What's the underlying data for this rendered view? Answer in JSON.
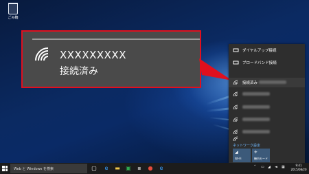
{
  "desktop": {
    "recycle_bin_label": "ごみ箱"
  },
  "callout": {
    "ssid": "XXXXXXXXX",
    "status": "接続済み"
  },
  "network_panel": {
    "items": [
      {
        "label": "ダイヤルアップ接続",
        "icon": "dialup-icon"
      },
      {
        "label": "ブロードバンド接続",
        "icon": "broadband-icon"
      },
      {
        "label": "接続済み",
        "icon": "wifi-icon",
        "selected": true
      },
      {
        "label": "",
        "icon": "wifi-icon"
      },
      {
        "label": "",
        "icon": "wifi-icon"
      },
      {
        "label": "",
        "icon": "wifi-icon"
      },
      {
        "label": "",
        "icon": "wifi-icon"
      },
      {
        "label": "",
        "icon": "wifi-icon"
      }
    ],
    "settings_link": "ネットワーク設定",
    "tiles": [
      {
        "label": "Wi-Fi",
        "icon": "wifi-icon"
      },
      {
        "label": "機内モード",
        "icon": "airplane-icon"
      }
    ]
  },
  "taskbar": {
    "search_placeholder": "Web と Windows を検索",
    "clock_time": "9:41",
    "clock_date": "2015/08/20"
  },
  "colors": {
    "callout_border": "#e0101e",
    "panel_bg": "#2e2e2e",
    "taskbar_bg": "#1c1c1c",
    "tile_bg": "#3c5a7a"
  }
}
